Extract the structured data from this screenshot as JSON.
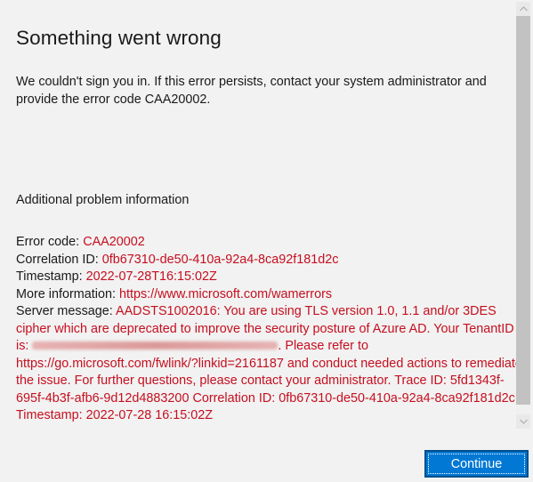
{
  "dialog": {
    "title": "Something went wrong",
    "intro": "We couldn't sign you in. If this error persists, contact your system administrator and provide the error code CAA20002.",
    "section_heading": "Additional problem information"
  },
  "details": {
    "error_code": {
      "label": "Error code: ",
      "value": "CAA20002"
    },
    "correlation_id": {
      "label": "Correlation ID: ",
      "value": "0fb67310-de50-410a-92a4-8ca92f181d2c"
    },
    "timestamp": {
      "label": "Timestamp: ",
      "value": "2022-07-28T16:15:02Z"
    },
    "more_information": {
      "label": "More information: ",
      "value": "https://www.microsoft.com/wamerrors"
    },
    "server_message": {
      "label": "Server message: ",
      "value_part1": "AADSTS1002016: You are using TLS version 1.0, 1.1 and/or 3DES cipher which are deprecated to improve the security posture of Azure AD. Your TenantID is: ",
      "tenant_id_redacted": "[redacted]",
      "value_part2": ". Please refer to https://go.microsoft.com/fwlink/?linkid=2161187 and conduct needed actions to remediate the issue. For further questions, please contact your administrator. Trace ID: 5fd1343f-695f-4b3f-afb6-9d12d4883200 Correlation ID: 0fb67310-de50-410a-92a4-8ca92f181d2c Timestamp: 2022-07-28 16:15:02Z"
    }
  },
  "scrollbar": {
    "up_icon": "chevron-up-icon",
    "down_icon": "chevron-down-icon"
  },
  "buttons": {
    "continue_label": "Continue"
  },
  "colors": {
    "background": "#f2f2f2",
    "error_text": "#c50f1f",
    "primary_button": "#0078d4",
    "primary_button_border": "#004e8c",
    "scroll_thumb": "#c2c2c2"
  }
}
